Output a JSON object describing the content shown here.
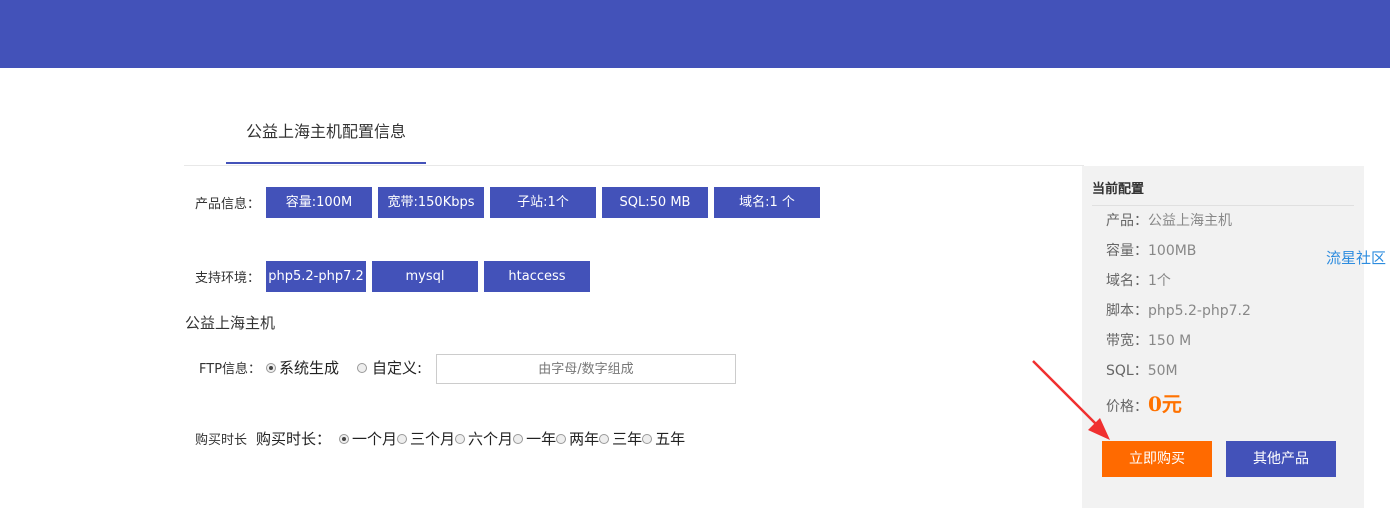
{
  "tab": {
    "label": "公益上海主机配置信息"
  },
  "product_info": {
    "label": "产品信息：",
    "chips": [
      "容量:100M",
      "宽带:150Kbps",
      "子站:1个",
      "SQL:50 MB",
      "域名:1 个"
    ]
  },
  "environment": {
    "label": "支持环境：",
    "chips": [
      "php5.2-php7.2",
      "mysql",
      "htaccess"
    ]
  },
  "section_title": "公益上海主机",
  "ftp": {
    "label": "FTP信息：",
    "option_system": "系统生成",
    "option_custom": "自定义:",
    "placeholder": "由字母/数字组成",
    "selected": "系统生成"
  },
  "duration": {
    "label_small": "购买时长",
    "label": "购买时长：",
    "options": [
      "一个月",
      "三个月",
      "六个月",
      "一年",
      "两年",
      "三年",
      "五年"
    ],
    "selected": "一个月"
  },
  "current_config": {
    "title": "当前配置",
    "rows": [
      {
        "key": "产品：",
        "value": "公益上海主机"
      },
      {
        "key": "容量：",
        "value": "100MB"
      },
      {
        "key": "域名：",
        "value": "1个"
      },
      {
        "key": "脚本：",
        "value": "php5.2-php7.2"
      },
      {
        "key": "带宽：",
        "value": "150 M"
      },
      {
        "key": "SQL：",
        "value": "50M"
      }
    ],
    "price_key": "价格：",
    "price_value": "0元",
    "buy_button": "立即购买",
    "other_button": "其他产品"
  },
  "side_link": "流星社区",
  "colors": {
    "brand": "#4352b9",
    "accent": "#ff6a00",
    "price": "#ff7200",
    "annotation_arrow": "#f03030"
  }
}
